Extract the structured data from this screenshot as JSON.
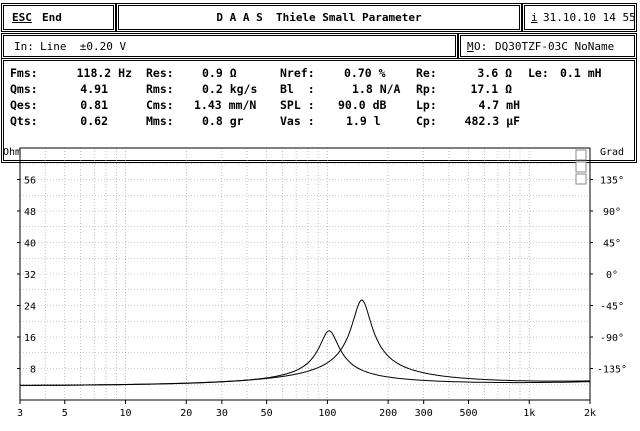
{
  "header": {
    "esc_key": "ESC",
    "end_label": "End",
    "title": "D A A S  Thiele Small Parameter",
    "info_key": "i",
    "datetime": "31.10.10 14 55"
  },
  "input": {
    "label": "In:",
    "value": "Line  ±0.20 V"
  },
  "model": {
    "key": "M",
    "label": "O:",
    "value": "DQ30TZF-03C NoName"
  },
  "parameters": {
    "fms": {
      "label": "Fms:",
      "value": "118.2 Hz"
    },
    "qms": {
      "label": "Qms:",
      "value": "4.91"
    },
    "qes": {
      "label": "Qes:",
      "value": "0.81"
    },
    "qts": {
      "label": "Qts:",
      "value": "0.62"
    },
    "res": {
      "label": "Res:",
      "value": "0.9 Ω"
    },
    "rms": {
      "label": "Rms:",
      "value": "0.2 kg/s"
    },
    "cms": {
      "label": "Cms:",
      "value": "1.43 mm/N"
    },
    "mms": {
      "label": "Mms:",
      "value": "0.8 gr"
    },
    "nref": {
      "label": "Nref:",
      "value": "0.70 %"
    },
    "bl": {
      "label": "Bl  :",
      "value": "1.8 N/A"
    },
    "spl": {
      "label": "SPL :",
      "value": "90.0 dB"
    },
    "vas": {
      "label": "Vas :",
      "value": "1.9 l"
    },
    "re": {
      "label": "Re:",
      "value": "3.6 Ω"
    },
    "rp": {
      "label": "Rp:",
      "value": "17.1 Ω"
    },
    "lp": {
      "label": "Lp:",
      "value": "4.7 mH"
    },
    "cp": {
      "label": "Cp:",
      "value": "482.3 µF"
    },
    "le": {
      "label": "Le:",
      "value": "0.1 mH"
    }
  },
  "chart_data": {
    "type": "line",
    "xscale": "log",
    "xlim": [
      3,
      2000
    ],
    "ylabel": "Ohm",
    "y2label": "Grad",
    "ylim": [
      0,
      64
    ],
    "y2lim": [
      -180,
      180
    ],
    "x_ticks": [
      "3",
      "5",
      "10",
      "20",
      "30",
      "50",
      "100",
      "200",
      "300",
      "500",
      "1k",
      "2k"
    ],
    "x_tick_values": [
      3,
      5,
      10,
      20,
      30,
      50,
      100,
      200,
      300,
      500,
      1000,
      2000
    ],
    "y_ticks": [
      "56",
      "48",
      "40",
      "32",
      "24",
      "16",
      "8"
    ],
    "y_tick_values": [
      56,
      48,
      40,
      32,
      24,
      16,
      8
    ],
    "y2_ticks": [
      "135°",
      "90°",
      "45°",
      "0°",
      "-45°",
      "-90°",
      "-135°"
    ],
    "y2_tick_values": [
      135,
      90,
      45,
      0,
      -45,
      -90,
      -135
    ],
    "grid": true,
    "series": [
      {
        "curve": "impedance_1",
        "peak_x": 102,
        "peak_y": 17.5,
        "base_y": 3.6,
        "q": 4.5,
        "x": [
          3,
          20,
          50,
          70,
          85,
          95,
          102,
          110,
          125,
          150,
          200,
          500,
          1000,
          2000
        ],
        "y": [
          3.6,
          3.6,
          3.9,
          5.0,
          8.0,
          13.0,
          17.5,
          15.5,
          9.0,
          6.0,
          4.5,
          3.8,
          4.0,
          4.4
        ]
      },
      {
        "curve": "impedance_2",
        "peak_x": 148,
        "peak_y": 25.3,
        "base_y": 3.6,
        "q": 4.5,
        "x": [
          3,
          20,
          50,
          90,
          120,
          140,
          148,
          160,
          190,
          250,
          400,
          1000,
          2000
        ],
        "y": [
          3.6,
          3.6,
          3.7,
          5.0,
          10.0,
          20.0,
          25.3,
          20.0,
          10.0,
          6.0,
          4.2,
          4.0,
          4.4
        ]
      }
    ]
  }
}
